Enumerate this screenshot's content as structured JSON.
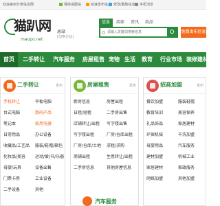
{
  "topbar": {
    "welcome": "欢迎来到分类信息网",
    "report": "保持说服信",
    "post": "快速发布信息",
    "delete": "修改/删除信息",
    "phone": "手机浏览"
  },
  "header": {
    "logo_text": "猫趴网",
    "logo_sub": "maopo.net",
    "city": "总站",
    "city_switch": "[切换分站]",
    "search_tabs": [
      "信息",
      "商家",
      "资讯",
      "商品"
    ],
    "search_placeholder": "请输入关键词搜索信息",
    "post_button": "免费发布信息"
  },
  "nav": {
    "items": [
      "首页",
      "二手转让",
      "汽车服务",
      "房屋租售",
      "宠物",
      "生活",
      "教育",
      "行业市场",
      "装修建材"
    ]
  },
  "panels": [
    {
      "title": "二手转让",
      "post_label": "发布",
      "rows": [
        [
          "手机转让",
          "平板电脑"
        ],
        [
          "台式电脑",
          "数码产品"
        ],
        [
          "笔记本",
          "家用电器"
        ],
        [
          "日常用品",
          "办公设备"
        ],
        [
          "收藏品/工艺品",
          "服装/鞋帽/箱包"
        ],
        [
          "化妆品/美容",
          "运动/爱/书/乐器"
        ],
        [
          "母婴/玩具",
          "设备出售"
        ],
        [
          "门票卡券",
          "工业设备"
        ],
        [
          "二手设备",
          "其他"
        ]
      ],
      "highlight": [
        "手机转让",
        "数码产品",
        "家用电器"
      ]
    },
    {
      "title": "房屋租售",
      "post_label": "发布",
      "rows": [
        [
          "新房信息",
          "房屋出租"
        ],
        [
          "日租/短租",
          "二手房出售"
        ],
        [
          "店铺转让/出租",
          "写字楼出售"
        ],
        [
          "写字楼出租",
          "厂房/仓库出租"
        ],
        [
          "厂房/仓库/土地",
          "求租/求购"
        ],
        [
          "商铺出租",
          "生意转让/出租"
        ],
        [
          "二手房信息",
          "其他房屋信息"
        ]
      ],
      "highlight": []
    },
    {
      "title": "招商加盟",
      "post_label": "发布",
      "rows": [
        [
          "餐饮加盟",
          "服装鞋帽"
        ],
        [
          "教育培训",
          "美容保养"
        ],
        [
          "礼品饰品",
          "家居建材"
        ],
        [
          "环保机械",
          "干洗加盟"
        ],
        [
          "母婴用品",
          "汽车服务"
        ],
        [
          "建材加盟",
          "机械工业"
        ],
        [
          "家居建材",
          "家政服务"
        ],
        [
          "网络加盟",
          "其他加盟"
        ]
      ],
      "highlight": []
    }
  ],
  "bottom_panel": {
    "title": "汽车服务"
  }
}
